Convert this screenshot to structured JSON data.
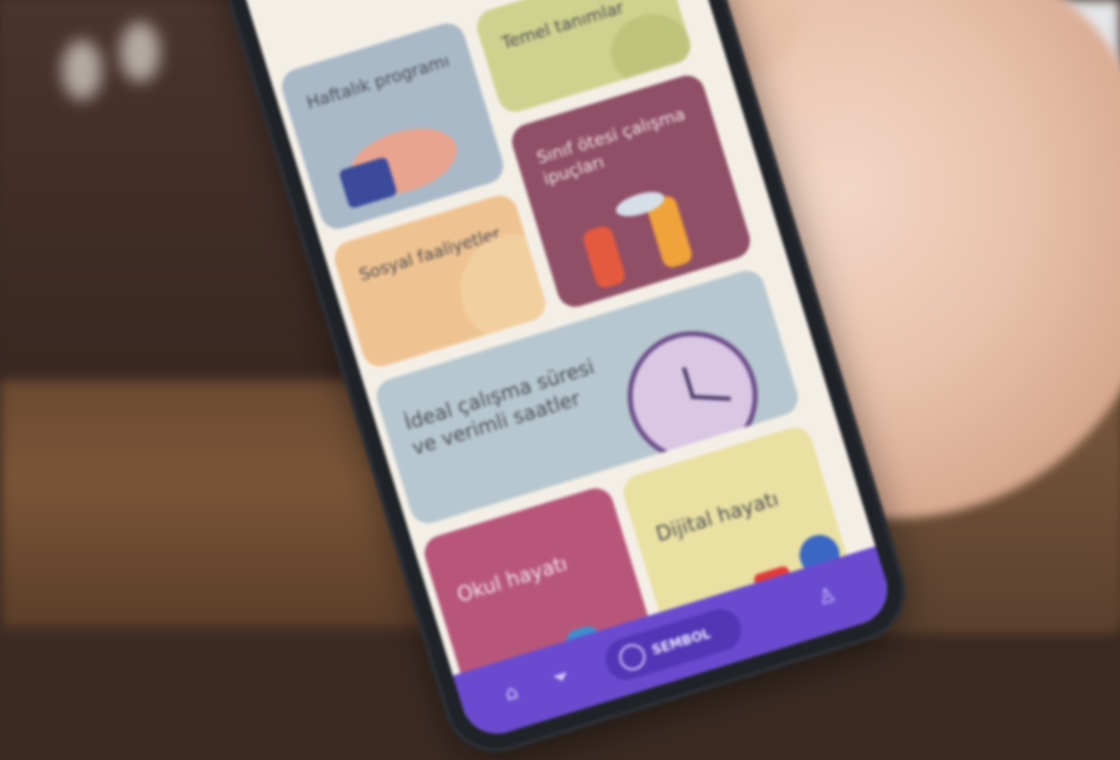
{
  "app": {
    "cards": {
      "weekly": "Haftalık programı",
      "basic": "Temel tanımlar",
      "beyond": "Sınıf ötesi çalışma ipuçları",
      "social": "Sosyal faaliyetler",
      "ideal": "İdeal çalışma süresi ve verimli saatler",
      "school": "Okul hayatı",
      "digital": "Dijital hayatı"
    },
    "nav": {
      "active_label": "SEMBOL"
    }
  },
  "colors": {
    "nav_bar": "#6a4bd0",
    "card_school": "#b8567a",
    "card_beyond": "#8f4f66",
    "card_ideal": "#b7c7cf",
    "card_digital": "#e9e0a2",
    "card_social": "#efc391",
    "card_basic": "#cfd28f",
    "card_weekly": "#a9b9c8"
  },
  "icons": [
    "clock-icon",
    "home-icon",
    "filter-icon",
    "person-icon",
    "youtube-icon"
  ]
}
